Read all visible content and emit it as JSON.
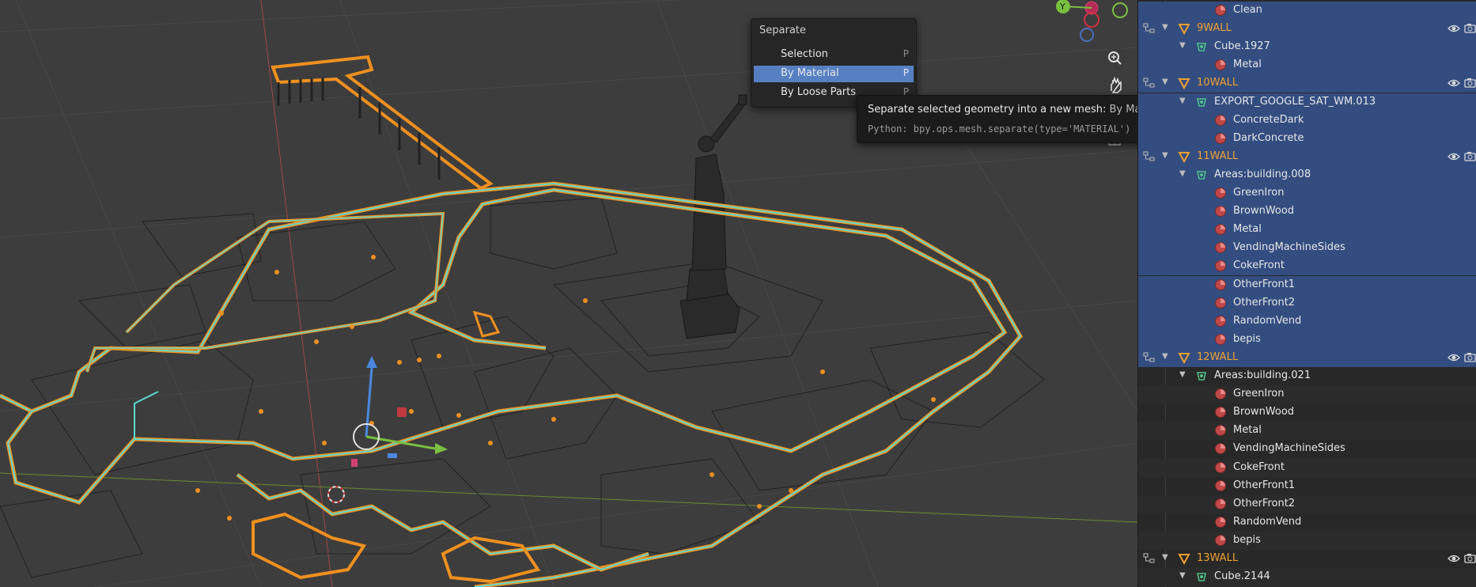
{
  "menu": {
    "title": "Separate",
    "items": [
      {
        "label": "Selection",
        "shortcut": "P"
      },
      {
        "label": "By Material",
        "shortcut": "P"
      },
      {
        "label": "By Loose Parts",
        "shortcut": "P"
      }
    ]
  },
  "tooltip": {
    "description": "Separate selected geometry into a new mesh: ",
    "item": "By Material",
    "python": "Python: bpy.ops.mesh.separate(type='MATERIAL')"
  },
  "gizmo": {
    "y_label": "Y"
  },
  "colors": {
    "selection_orange": "#f0901e",
    "selection_cyan": "#5fd8d0",
    "outliner_selected": "#334d80",
    "menu_highlight": "#5680c2"
  },
  "outliner": [
    {
      "type": "material",
      "label": "Clean",
      "selected": true
    },
    {
      "type": "object",
      "label": "9WALL",
      "selected": true
    },
    {
      "type": "mesh",
      "label": "Cube.1927",
      "selected": true
    },
    {
      "type": "material",
      "label": "Metal",
      "selected": true
    },
    {
      "type": "object",
      "label": "10WALL",
      "selected": true
    },
    {
      "type": "mesh",
      "label": "EXPORT_GOOGLE_SAT_WM.013",
      "selected": true
    },
    {
      "type": "material",
      "label": "ConcreteDark",
      "selected": true
    },
    {
      "type": "material",
      "label": "DarkConcrete",
      "selected": true
    },
    {
      "type": "object",
      "label": "11WALL",
      "selected": true
    },
    {
      "type": "mesh",
      "label": "Areas:building.008",
      "selected": true
    },
    {
      "type": "material",
      "label": "GreenIron",
      "selected": true
    },
    {
      "type": "material",
      "label": "BrownWood",
      "selected": true
    },
    {
      "type": "material",
      "label": "Metal",
      "selected": true
    },
    {
      "type": "material",
      "label": "VendingMachineSides",
      "selected": true
    },
    {
      "type": "material",
      "label": "CokeFront",
      "selected": true
    },
    {
      "type": "material",
      "label": "OtherFront1",
      "selected": true
    },
    {
      "type": "material",
      "label": "OtherFront2",
      "selected": true
    },
    {
      "type": "material",
      "label": "RandomVend",
      "selected": true
    },
    {
      "type": "material",
      "label": "bepis",
      "selected": true
    },
    {
      "type": "object",
      "label": "12WALL",
      "selected": true
    },
    {
      "type": "mesh",
      "label": "Areas:building.021",
      "selected": false
    },
    {
      "type": "material",
      "label": "GreenIron",
      "selected": false
    },
    {
      "type": "material",
      "label": "BrownWood",
      "selected": false
    },
    {
      "type": "material",
      "label": "Metal",
      "selected": false
    },
    {
      "type": "material",
      "label": "VendingMachineSides",
      "selected": false
    },
    {
      "type": "material",
      "label": "CokeFront",
      "selected": false
    },
    {
      "type": "material",
      "label": "OtherFront1",
      "selected": false
    },
    {
      "type": "material",
      "label": "OtherFront2",
      "selected": false
    },
    {
      "type": "material",
      "label": "RandomVend",
      "selected": false
    },
    {
      "type": "material",
      "label": "bepis",
      "selected": false
    },
    {
      "type": "object",
      "label": "13WALL",
      "selected": false
    },
    {
      "type": "mesh",
      "label": "Cube.2144",
      "selected": false
    }
  ]
}
